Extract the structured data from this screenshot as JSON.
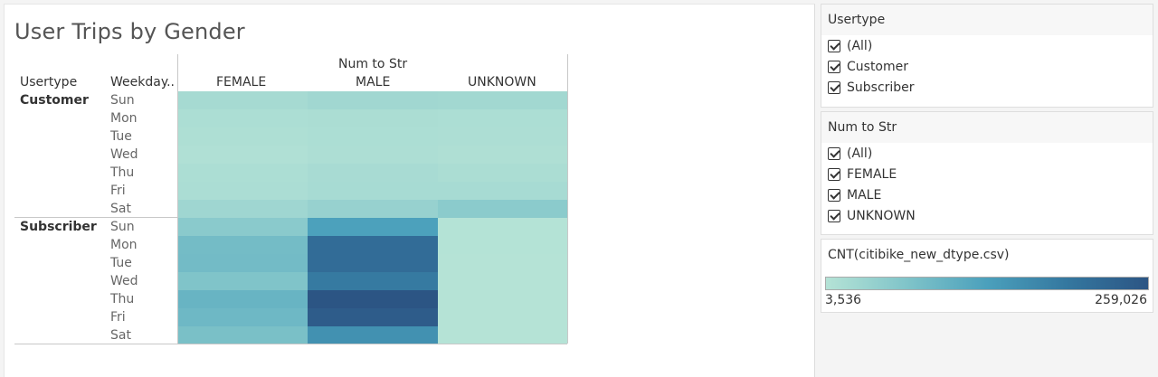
{
  "title": "User Trips by Gender",
  "headers": {
    "usertype": "Usertype",
    "weekday": "Weekday..",
    "group_title": "Num to Str",
    "columns": [
      "FEMALE",
      "MALE",
      "UNKNOWN"
    ]
  },
  "groups": [
    "Customer",
    "Subscriber"
  ],
  "weekdays": [
    "Sun",
    "Mon",
    "Tue",
    "Wed",
    "Thu",
    "Fri",
    "Sat"
  ],
  "chart_data": {
    "type": "heatmap",
    "title": "User Trips by Gender",
    "x_categories": [
      "FEMALE",
      "MALE",
      "UNKNOWN"
    ],
    "y_groups": [
      "Customer",
      "Subscriber"
    ],
    "y_categories": [
      "Sun",
      "Mon",
      "Tue",
      "Wed",
      "Thu",
      "Fri",
      "Sat"
    ],
    "measure": "CNT(citibike_new_dtype.csv)",
    "color_range": [
      3536,
      259026
    ],
    "colors": [
      "#b5e3d6",
      "#2c5584"
    ],
    "values": {
      "Customer": [
        [
          22000,
          28000,
          26000
        ],
        [
          14000,
          16000,
          14000
        ],
        [
          12000,
          14000,
          13000
        ],
        [
          10000,
          13000,
          11000
        ],
        [
          14000,
          19000,
          16000
        ],
        [
          15000,
          20000,
          20000
        ],
        [
          30000,
          40000,
          54000
        ]
      ],
      "Subscriber": [
        [
          55000,
          130000,
          4500
        ],
        [
          82000,
          215000,
          4200
        ],
        [
          83000,
          215000,
          4000
        ],
        [
          68000,
          190000,
          3900
        ],
        [
          96000,
          259026,
          3800
        ],
        [
          89000,
          245000,
          3700
        ],
        [
          75000,
          155000,
          3536
        ]
      ]
    }
  },
  "filters": [
    {
      "title": "Usertype",
      "options": [
        "(All)",
        "Customer",
        "Subscriber"
      ]
    },
    {
      "title": "Num to Str",
      "options": [
        "(All)",
        "FEMALE",
        "MALE",
        "UNKNOWN"
      ]
    }
  ],
  "legend": {
    "title": "CNT(citibike_new_dtype.csv)",
    "min_label": "3,536",
    "max_label": "259,026"
  }
}
